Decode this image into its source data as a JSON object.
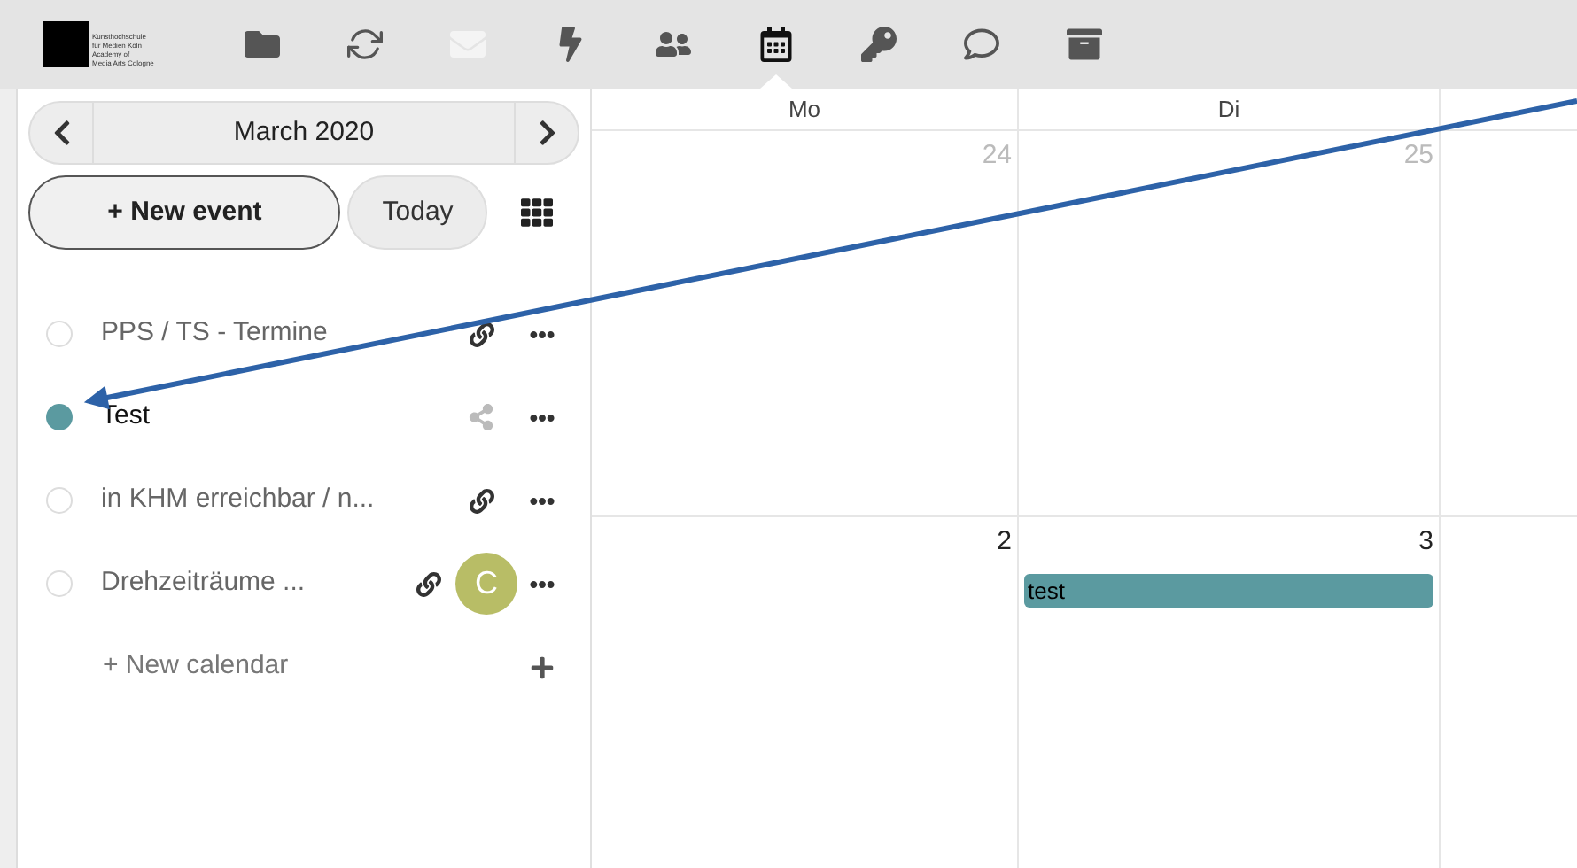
{
  "logo": {
    "lines": [
      "Kunsthochschule",
      "für Medien Köln",
      "Academy of",
      "Media Arts Cologne"
    ]
  },
  "apps": [
    {
      "kind": "files",
      "selected": false,
      "disabled": false
    },
    {
      "kind": "activity",
      "selected": false,
      "disabled": false
    },
    {
      "kind": "mail",
      "selected": false,
      "disabled": true
    },
    {
      "kind": "flash",
      "selected": false,
      "disabled": false
    },
    {
      "kind": "contacts",
      "selected": false,
      "disabled": false
    },
    {
      "kind": "calendar",
      "selected": true,
      "disabled": false
    },
    {
      "kind": "passwords",
      "selected": false,
      "disabled": false
    },
    {
      "kind": "talk",
      "selected": false,
      "disabled": false
    },
    {
      "kind": "deck",
      "selected": false,
      "disabled": false
    }
  ],
  "sidebar": {
    "month": "March 2020",
    "new_event": "+ New event",
    "today": "Today",
    "calendars": [
      {
        "name": "PPS / TS - Termine",
        "enabled": false,
        "kind": "link"
      },
      {
        "name": "Test",
        "enabled": true,
        "color": "#5b9aa0",
        "kind": "share"
      },
      {
        "name": "in KHM erreichbar / n...",
        "enabled": false,
        "kind": "link"
      },
      {
        "name": "Drehzeiträume ...",
        "enabled": false,
        "kind": "link",
        "avatar": "C"
      }
    ],
    "new_calendar": "+ New calendar"
  },
  "calendar": {
    "days": [
      "Mo",
      "Di"
    ],
    "weeks": [
      {
        "dates": [
          {
            "day": "24",
            "other_month": true
          },
          {
            "day": "25",
            "other_month": true
          }
        ]
      },
      {
        "dates": [
          {
            "day": "2",
            "other_month": false
          },
          {
            "day": "3",
            "other_month": false,
            "events": [
              {
                "title": "test",
                "color": "#5b9aa0"
              }
            ]
          }
        ]
      }
    ]
  },
  "annotation": {
    "kind": "arrow"
  }
}
